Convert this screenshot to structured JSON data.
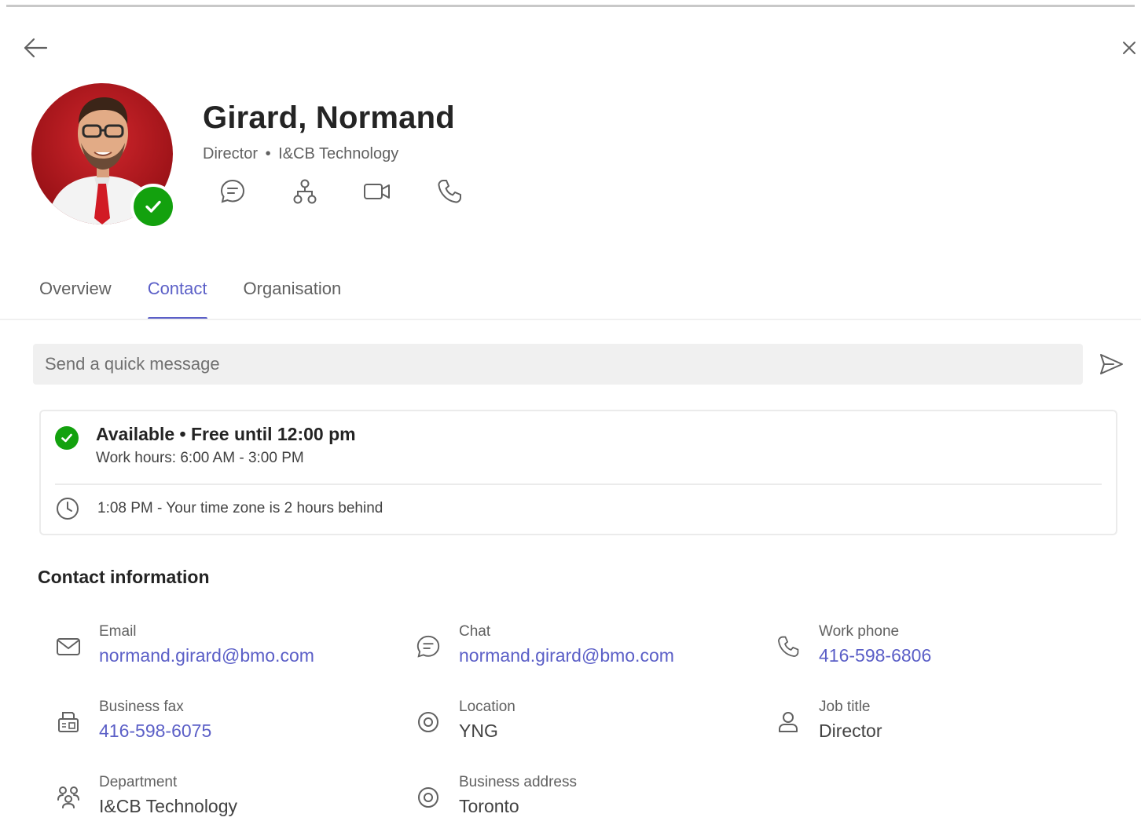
{
  "profile": {
    "name": "Girard, Normand",
    "role": "Director",
    "separator": "•",
    "department": "I&CB Technology",
    "presence_color": "#13a10e"
  },
  "actions": [
    {
      "name": "chat",
      "icon": "chat-icon"
    },
    {
      "name": "org-chart",
      "icon": "org-chart-icon"
    },
    {
      "name": "video-call",
      "icon": "video-icon"
    },
    {
      "name": "audio-call",
      "icon": "phone-icon"
    }
  ],
  "tabs": [
    {
      "label": "Overview",
      "active": false
    },
    {
      "label": "Contact",
      "active": true
    },
    {
      "label": "Organisation",
      "active": false
    }
  ],
  "quick_message": {
    "placeholder": "Send a quick message",
    "value": ""
  },
  "availability": {
    "status": "Available • Free until 12:00 pm",
    "work_hours": "Work hours: 6:00 AM - 3:00 PM",
    "local_time": "1:08 PM - Your time zone is 2 hours behind"
  },
  "contact_info": {
    "title": "Contact information",
    "items": [
      {
        "label": "Email",
        "value": "normand.girard@bmo.com",
        "icon": "mail-icon",
        "link": true
      },
      {
        "label": "Chat",
        "value": "normand.girard@bmo.com",
        "icon": "chat-icon",
        "link": true
      },
      {
        "label": "Work phone",
        "value": "416-598-6806",
        "icon": "phone-icon",
        "link": true
      },
      {
        "label": "Business fax",
        "value": "416-598-6075",
        "icon": "fax-icon",
        "link": true
      },
      {
        "label": "Location",
        "value": "YNG",
        "icon": "location-icon",
        "link": false
      },
      {
        "label": "Job title",
        "value": "Director",
        "icon": "person-icon",
        "link": false
      },
      {
        "label": "Department",
        "value": "I&CB Technology",
        "icon": "department-icon",
        "link": false
      },
      {
        "label": "Business address",
        "value": "Toronto",
        "icon": "location-icon",
        "link": false
      }
    ]
  },
  "colors": {
    "accent": "#5b5fc7",
    "available": "#13a10e"
  }
}
